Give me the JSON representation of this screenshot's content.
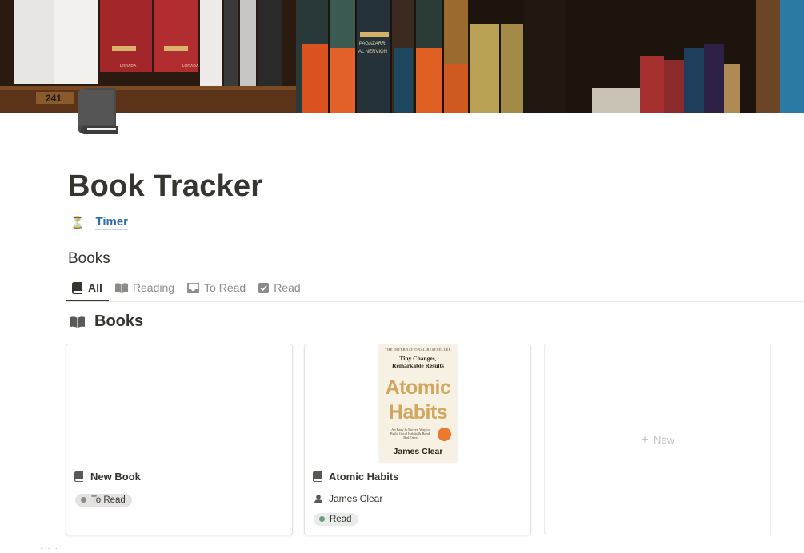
{
  "page": {
    "title": "Book Tracker",
    "icon": "book-icon"
  },
  "cover": {
    "spine_number": "241",
    "spine_labels": [
      "LORADA",
      "LORADA",
      "PAGAZARRI",
      "AL NERVION"
    ]
  },
  "timer_link": {
    "icon": "hourglass-icon",
    "emoji": "⏳",
    "label": "Timer"
  },
  "database": {
    "title": "Books",
    "tabs": [
      {
        "label": "All",
        "icon": "book-icon",
        "active": true
      },
      {
        "label": "Reading",
        "icon": "open-book-icon",
        "active": false
      },
      {
        "label": "To Read",
        "icon": "inbox-icon",
        "active": false
      },
      {
        "label": "Read",
        "icon": "checkbox-icon",
        "active": false
      }
    ],
    "view": {
      "title": "Books",
      "icon": "open-book-icon"
    },
    "cards": [
      {
        "title": "New Book",
        "icon": "book-icon",
        "status": "To Read",
        "status_color": "#8c8b87"
      },
      {
        "title": "Atomic Habits",
        "icon": "book-icon",
        "author": "James Clear",
        "author_icon": "person-icon",
        "status": "Read",
        "status_color": "#6c9b7d",
        "cover_art": {
          "bestseller": "THE INTERNATIONAL BESTSELLER",
          "subtitle_line1": "Tiny Changes,",
          "subtitle_line2": "Remarkable Results",
          "title_line1": "Atomic",
          "title_line2": "Habits",
          "tagline": "An Easy & Proven Way to Build Good Habits & Break Bad Ones",
          "author": "James Clear"
        }
      }
    ],
    "new_button_label": "New",
    "new_button_icon": "plus-icon"
  },
  "colors": {
    "text": "#37352f",
    "link": "#2f6fab",
    "muted": "#8c8b87"
  }
}
